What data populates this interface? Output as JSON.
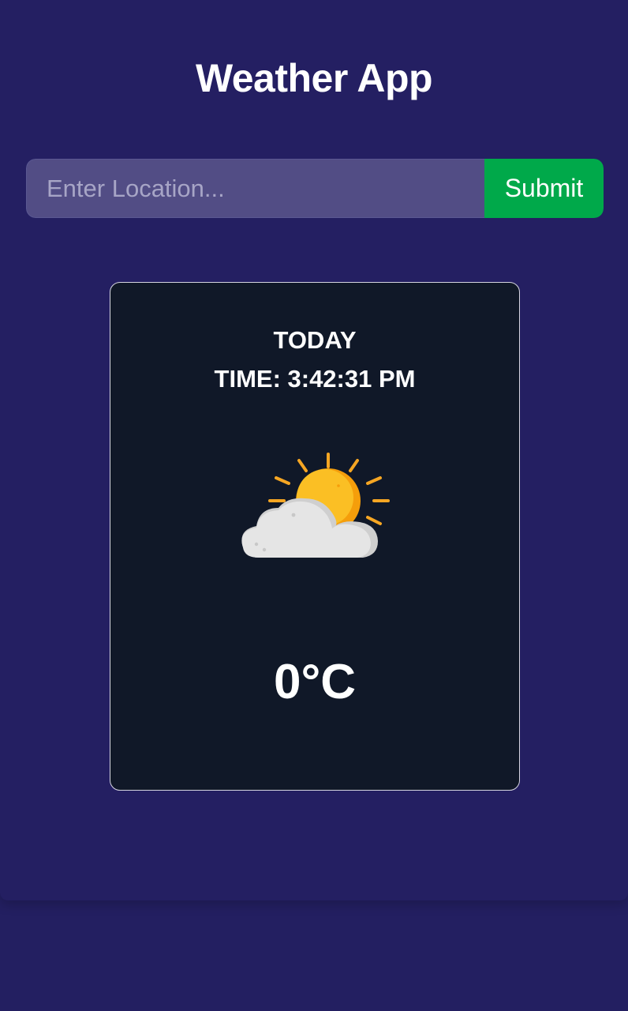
{
  "header": {
    "title": "Weather App"
  },
  "search": {
    "placeholder": "Enter Location...",
    "value": "",
    "submit_label": "Submit"
  },
  "weather_card": {
    "day": "TODAY",
    "time": "TIME: 3:42:31 PM",
    "icon": "partly-cloudy-icon",
    "temperature": "0°C"
  },
  "colors": {
    "background": "#241f62",
    "card_background": "#101828",
    "submit_button": "#00a94a",
    "input_background": "#524d85",
    "sun": "#fbbf24",
    "cloud": "#e5e5e5"
  }
}
